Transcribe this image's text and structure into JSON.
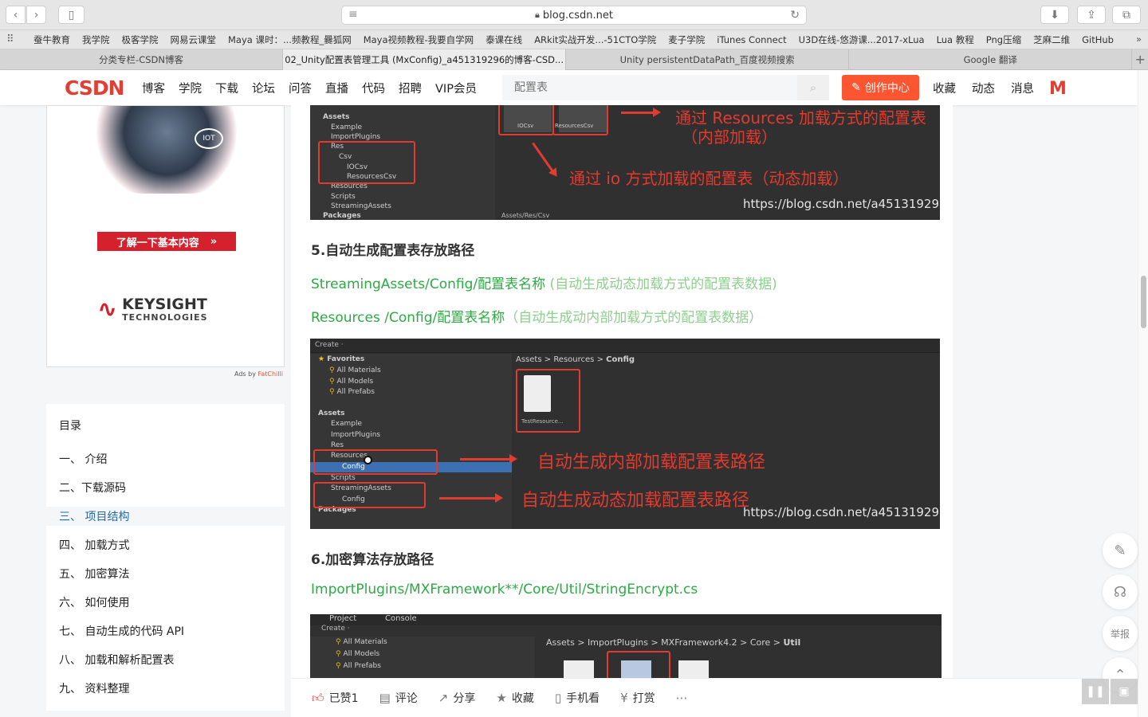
{
  "browser": {
    "url": "blog.csdn.net",
    "bookmarks": [
      "蚕牛教育",
      "我学院",
      "极客学院",
      "网易云课堂",
      "Maya 课时：...频教程_爨狐网",
      "Maya视频教程-我要自学网",
      "泰课在线",
      "ARkit实战开发...-51CTO学院",
      "麦子学院",
      "iTunes Connect",
      "U3D在线-悠游课...2017-xLua",
      "Lua 教程",
      "Png压缩",
      "芝麻二维",
      "GitHub"
    ],
    "tabs": [
      {
        "label": "分类专栏-CSDN博客",
        "active": false
      },
      {
        "label": "02_Unity配置表管理工具 (MxConfig)_a451319296的博客-CSD...",
        "active": true
      },
      {
        "label": "Unity persistentDataPath_百度视频搜索",
        "active": false
      },
      {
        "label": "Google 翻译",
        "active": false
      }
    ]
  },
  "csdn": {
    "logo": "CSDN",
    "nav": [
      "博客",
      "学院",
      "下载",
      "论坛",
      "问答",
      "直播",
      "代码",
      "招聘",
      "VIP会员"
    ],
    "search_placeholder": "配置表",
    "create_label": "创作中心",
    "right_nav": [
      "收藏",
      "动态",
      "消息"
    ],
    "avatar_letter": "M"
  },
  "ad": {
    "button": "了解一下基本内容",
    "brand1": "KEYSIGHT",
    "brand2": "TECHNOLOGIES",
    "iot": "IOT",
    "ads_by": "Ads by",
    "ads_vendor": "FatChilli"
  },
  "toc": {
    "title": "目录",
    "items": [
      {
        "label": "一、 介绍",
        "active": false
      },
      {
        "label": "二、下载源码",
        "active": false
      },
      {
        "label": "三、 项目结构",
        "active": true
      },
      {
        "label": "四、 加载方式",
        "active": false
      },
      {
        "label": "五、 加密算法",
        "active": false
      },
      {
        "label": "六、 如何使用",
        "active": false
      },
      {
        "label": "七、 自动生成的代码 API",
        "active": false
      },
      {
        "label": "八、 加载和解析配置表",
        "active": false
      },
      {
        "label": "九、 资料整理",
        "active": false
      }
    ]
  },
  "article": {
    "shot1": {
      "tree": [
        "Assets",
        "Example",
        "ImportPlugins",
        "Res",
        "Csv",
        "IOCsv",
        "ResourcesCsv",
        "Resources",
        "Scripts",
        "StreamingAssets",
        "Packages"
      ],
      "folders": [
        "IOCsv",
        "ResourcesCsv"
      ],
      "path": "Assets/Res/Csv",
      "ann1a": "通过 Resources 加载方式的配置表",
      "ann1b": "（内部加载）",
      "ann2": "通过 io 方式加载的配置表（动态加载）",
      "watermark": "https://blog.csdn.net/a451319296"
    },
    "h5": "5.自动生成配置表存放路径",
    "p1_main": "StreamingAssets/Config/配置表名称",
    "p1_note": " (自动生成动态加载方式的配置表数据)",
    "p2_main": "Resources /Config/配置表名称",
    "p2_note": "（自动生成动内部加载方式的配置表数据）",
    "shot2": {
      "create": "Create ·",
      "tree": [
        "Favorites",
        "All Materials",
        "All Models",
        "All Prefabs",
        "Assets",
        "Example",
        "ImportPlugins",
        "Res",
        "Resources",
        "Config",
        "Scripts",
        "StreamingAssets",
        "Config",
        "Packages"
      ],
      "crumbs": [
        "Assets",
        ">",
        "Resources",
        ">",
        "Config"
      ],
      "file": "TestResource...",
      "ann1": "自动生成内部加载配置表路径",
      "ann2": "自动生成动态加载配置表路径",
      "watermark": "https://blog.csdn.net/a451319296"
    },
    "h6": "6.加密算法存放路径",
    "p3": "ImportPlugins/MXFramework**/Core/Util/StringEncrypt.cs",
    "shot3": {
      "tabs": [
        "Project",
        "Console"
      ],
      "create": "Create ·",
      "tree": [
        "All Materials",
        "All Models",
        "All Prefabs"
      ],
      "crumbs": [
        "Assets",
        ">",
        "ImportPlugins",
        ">",
        "MXFramework4.2",
        ">",
        "Core",
        ">",
        "Util"
      ]
    }
  },
  "bottom": [
    {
      "icon": "thumbs-up-icon",
      "label": "已赞1"
    },
    {
      "icon": "comment-icon",
      "label": "评论"
    },
    {
      "icon": "share-icon",
      "label": "分享"
    },
    {
      "icon": "star-icon",
      "label": "收藏"
    },
    {
      "icon": "phone-icon",
      "label": "手机看"
    },
    {
      "icon": "coin-icon",
      "label": "打赏"
    }
  ],
  "float": {
    "report": "举报"
  }
}
